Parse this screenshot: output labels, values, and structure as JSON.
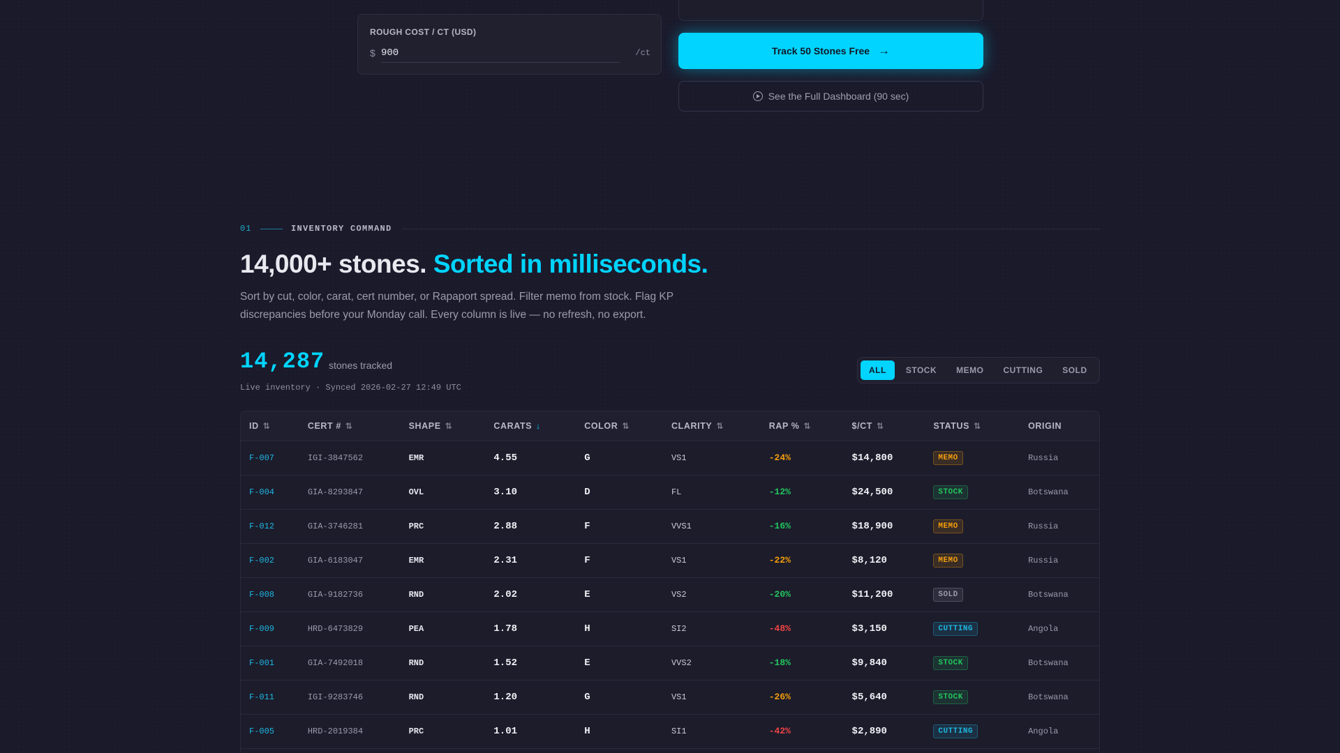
{
  "calculator": {
    "cost_label": "ROUGH COST / CT (USD)",
    "currency_symbol": "$",
    "cost_value": "900",
    "cost_unit": "/ct",
    "track_button": "Track 50 Stones Free",
    "dashboard_button": "See the Full Dashboard (90 sec)"
  },
  "section": {
    "number": "01",
    "name": "INVENTORY COMMAND",
    "headline_main": "14,000+ stones.",
    "headline_accent": "Sorted in milliseconds.",
    "subcopy": "Sort by cut, color, carat, cert number, or Rapaport spread. Filter memo from stock. Flag KP discrepancies before your Monday call. Every column is live — no refresh, no export."
  },
  "stats": {
    "count": "14,287",
    "count_label": "stones tracked",
    "sync_text": "Live inventory · Synced 2026-02-27 12:49 UTC"
  },
  "filters": [
    "ALL",
    "STOCK",
    "MEMO",
    "CUTTING",
    "SOLD"
  ],
  "active_filter": "ALL",
  "table": {
    "columns": [
      {
        "label": "ID",
        "sort": "⇅"
      },
      {
        "label": "CERT #",
        "sort": "⇅"
      },
      {
        "label": "SHAPE",
        "sort": "⇅"
      },
      {
        "label": "CARATS",
        "sort": "↓"
      },
      {
        "label": "COLOR",
        "sort": "⇅"
      },
      {
        "label": "CLARITY",
        "sort": "⇅"
      },
      {
        "label": "RAP %",
        "sort": "⇅"
      },
      {
        "label": "$/CT",
        "sort": "⇅"
      },
      {
        "label": "STATUS",
        "sort": "⇅"
      },
      {
        "label": "ORIGIN",
        "sort": ""
      }
    ],
    "rows": [
      {
        "id": "F-007",
        "cert": "IGI-3847562",
        "shape": "EMR",
        "carats": "4.55",
        "color": "G",
        "clarity": "VS1",
        "rap": "-24%",
        "price": "$14,800",
        "status": "MEMO",
        "origin": "Russia"
      },
      {
        "id": "F-004",
        "cert": "GIA-8293847",
        "shape": "OVL",
        "carats": "3.10",
        "color": "D",
        "clarity": "FL",
        "rap": "-12%",
        "price": "$24,500",
        "status": "STOCK",
        "origin": "Botswana"
      },
      {
        "id": "F-012",
        "cert": "GIA-3746281",
        "shape": "PRC",
        "carats": "2.88",
        "color": "F",
        "clarity": "VVS1",
        "rap": "-16%",
        "price": "$18,900",
        "status": "MEMO",
        "origin": "Russia"
      },
      {
        "id": "F-002",
        "cert": "GIA-6183047",
        "shape": "EMR",
        "carats": "2.31",
        "color": "F",
        "clarity": "VS1",
        "rap": "-22%",
        "price": "$8,120",
        "status": "MEMO",
        "origin": "Russia"
      },
      {
        "id": "F-008",
        "cert": "GIA-9182736",
        "shape": "RND",
        "carats": "2.02",
        "color": "E",
        "clarity": "VS2",
        "rap": "-20%",
        "price": "$11,200",
        "status": "SOLD",
        "origin": "Botswana"
      },
      {
        "id": "F-009",
        "cert": "HRD-6473829",
        "shape": "PEA",
        "carats": "1.78",
        "color": "H",
        "clarity": "SI2",
        "rap": "-48%",
        "price": "$3,150",
        "status": "CUTTING",
        "origin": "Angola"
      },
      {
        "id": "F-001",
        "cert": "GIA-7492018",
        "shape": "RND",
        "carats": "1.52",
        "color": "E",
        "clarity": "VVS2",
        "rap": "-18%",
        "price": "$9,840",
        "status": "STOCK",
        "origin": "Botswana"
      },
      {
        "id": "F-011",
        "cert": "IGI-9283746",
        "shape": "RND",
        "carats": "1.20",
        "color": "G",
        "clarity": "VS1",
        "rap": "-26%",
        "price": "$5,640",
        "status": "STOCK",
        "origin": "Botswana"
      },
      {
        "id": "F-005",
        "cert": "HRD-2019384",
        "shape": "PRC",
        "carats": "1.01",
        "color": "H",
        "clarity": "SI1",
        "rap": "-42%",
        "price": "$2,890",
        "status": "CUTTING",
        "origin": "Angola"
      }
    ]
  },
  "colors": {
    "accent": "#00d4ff",
    "rap_good": "#22c55e",
    "rap_mid": "#f59e0b",
    "rap_bad": "#ef4444",
    "status_memo": "#f59e0b",
    "status_stock": "#22c55e",
    "status_sold": "#9a9cab",
    "status_cutting": "#1fb6e0"
  },
  "icons": {
    "track_arrow": "arrow-right-icon",
    "dashboard": "play-circle-icon"
  }
}
